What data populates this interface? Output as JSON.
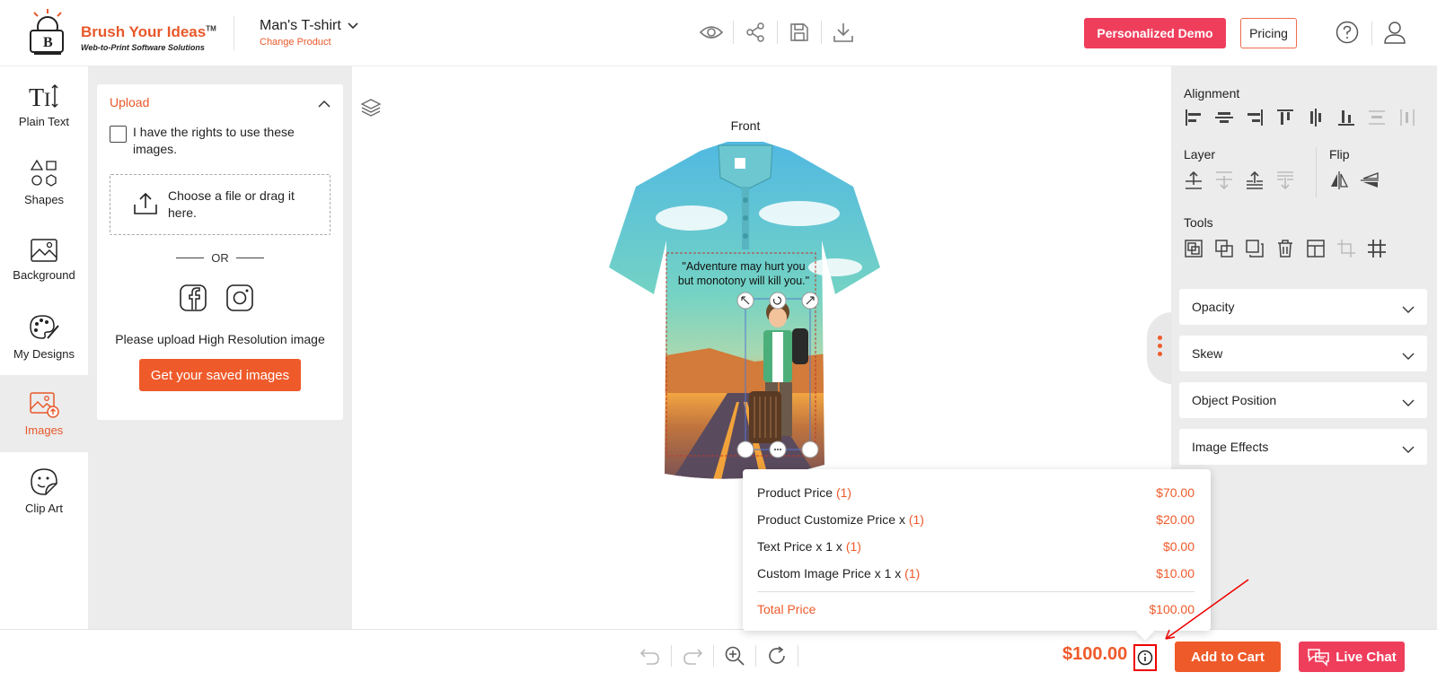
{
  "header": {
    "brand": "Brush Your Ideas",
    "brand_tm": "TM",
    "brand_tagline": "Web-to-Print Software Solutions",
    "product_name": "Man's T-shirt",
    "change_product": "Change Product",
    "toolbar_icons": [
      "eye-icon",
      "share-icon",
      "save-icon",
      "download-icon"
    ],
    "demo_button": "Personalized Demo",
    "pricing_button": "Pricing"
  },
  "sidebar": {
    "items": [
      {
        "label": "Plain Text",
        "icon": "text-icon"
      },
      {
        "label": "Shapes",
        "icon": "shapes-icon"
      },
      {
        "label": "Background",
        "icon": "background-icon"
      },
      {
        "label": "My Designs",
        "icon": "palette-icon"
      },
      {
        "label": "Images",
        "icon": "image-upload-icon",
        "active": true
      },
      {
        "label": "Clip Art",
        "icon": "clipart-icon"
      }
    ]
  },
  "upload": {
    "title": "Upload",
    "rights_label": "I have the rights to use these images.",
    "dropzone_text": "Choose a file or drag it here.",
    "or_text": "OR",
    "hi_res_note": "Please upload High Resolution image",
    "saved_button": "Get your saved images"
  },
  "canvas": {
    "side_label": "Front",
    "quote": "\"Adventure may hurt you but monotony will kill you.\""
  },
  "right_panel": {
    "alignment_title": "Alignment",
    "layer_title": "Layer",
    "flip_title": "Flip",
    "tools_title": "Tools",
    "accordions": [
      "Opacity",
      "Skew",
      "Object Position",
      "Image Effects"
    ]
  },
  "price_popup": {
    "rows": [
      {
        "label": "Product Price ",
        "qty": "(1)",
        "value": "$70.00"
      },
      {
        "label": "Product Customize Price x ",
        "qty": "(1)",
        "value": "$20.00"
      },
      {
        "label": "Text Price x 1 x ",
        "qty": "(1)",
        "value": "$0.00"
      },
      {
        "label": "Custom Image Price x 1 x ",
        "qty": "(1)",
        "value": "$10.00"
      }
    ],
    "total_label": "Total Price",
    "total_value": "$100.00"
  },
  "bottom": {
    "total": "$100.00",
    "add_to_cart": "Add to Cart",
    "live_chat": "Live Chat"
  },
  "colors": {
    "accent": "#ef5a2a",
    "pink": "#ef3e5c",
    "panel_gray": "#ececec"
  }
}
